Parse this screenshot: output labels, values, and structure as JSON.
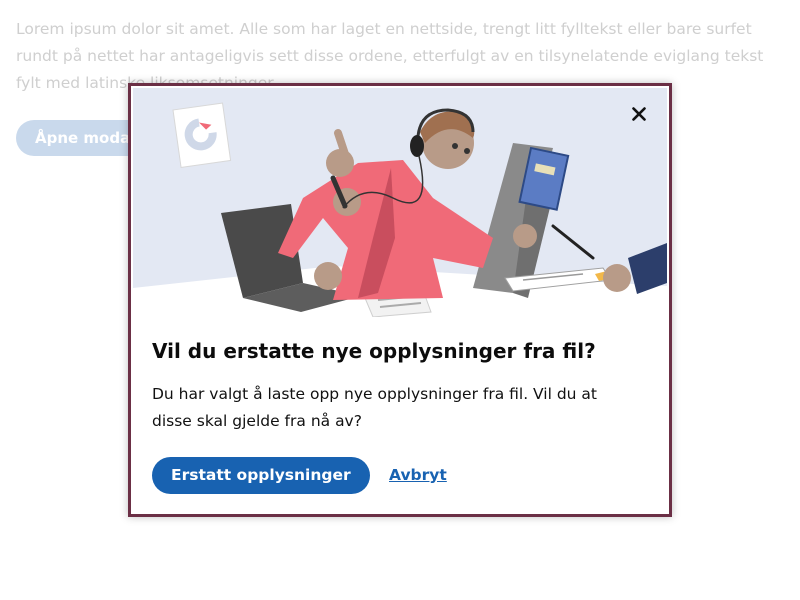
{
  "background_page": {
    "paragraph": "Lorem ipsum dolor sit amet. Alle som har laget en nettside, trengt litt fylltekst eller bare surfet rundt på nettet har antageligvis sett disse ordene, etterfulgt av en tilsynelatende eviglang tekst fylt med latinske liksomsetninger.",
    "open_modal_label": "Åpne modal"
  },
  "modal": {
    "close_icon": "close-icon",
    "title": "Vil du erstatte nye opplysninger fra fil?",
    "body": "Du har valgt å laste opp nye opplysninger fra fil. Vil du at disse skal gjelde fra nå av?",
    "confirm_label": "Erstatt opplysninger",
    "cancel_label": "Avbryt"
  },
  "colors": {
    "modal_border": "#6b2f45",
    "primary": "#1862b1",
    "illustration_bg": "#e3e8f3",
    "open_button_bg": "#c9d9ec"
  }
}
